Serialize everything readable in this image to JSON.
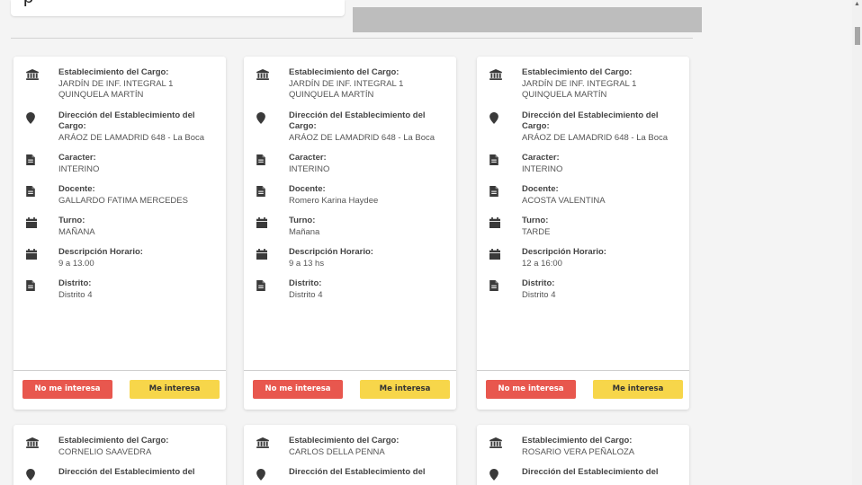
{
  "top": {
    "search_text": "p"
  },
  "labels": {
    "establecimiento": "Establecimiento del Cargo:",
    "direccion": "Dirección del Establecimiento del Cargo:",
    "direccion_partial": "Dirección del Establecimiento del",
    "caracter": "Caracter:",
    "docente": "Docente:",
    "turno": "Turno:",
    "descripcion": "Descripción Horario:",
    "distrito": "Distrito:"
  },
  "buttons": {
    "no_interesa": "No me interesa",
    "interesa": "Me interesa"
  },
  "cards": [
    {
      "establecimiento": "JARDÍN DE INF. INTEGRAL 1 QUINQUELA MARTÍN",
      "direccion": "ARÁOZ DE LAMADRID 648 - La Boca",
      "caracter": "INTERINO",
      "docente": "GALLARDO FATIMA MERCEDES",
      "turno": "MAÑANA",
      "descripcion": "9 a 13.00",
      "distrito": "Distrito 4"
    },
    {
      "establecimiento": "JARDÍN DE INF. INTEGRAL 1 QUINQUELA MARTÍN",
      "direccion": "ARÁOZ DE LAMADRID 648 - La Boca",
      "caracter": "INTERINO",
      "docente": "Romero Karina Haydee",
      "turno": "Mañana",
      "descripcion": "9 a 13 hs",
      "distrito": "Distrito 4"
    },
    {
      "establecimiento": "JARDÍN DE INF. INTEGRAL 1 QUINQUELA MARTÍN",
      "direccion": "ARÁOZ DE LAMADRID 648 - La Boca",
      "caracter": "INTERINO",
      "docente": "ACOSTA VALENTINA",
      "turno": "TARDE",
      "descripcion": "12 a 16:00",
      "distrito": "Distrito 4"
    },
    {
      "establecimiento": "CORNELIO SAAVEDRA"
    },
    {
      "establecimiento": "CARLOS DELLA PENNA"
    },
    {
      "establecimiento": "ROSARIO VERA PEÑALOZA"
    }
  ]
}
